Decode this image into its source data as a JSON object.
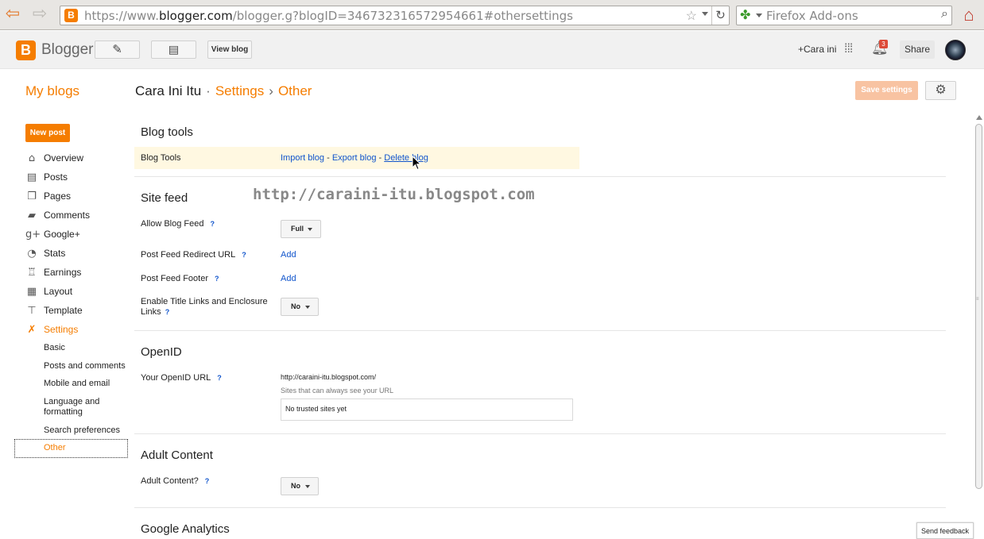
{
  "browser": {
    "url_host": "https://www.",
    "url_domain": "blogger.com",
    "url_path": "/blogger.g?blogID=346732316572954661#othersettings",
    "search_placeholder": "Firefox Add-ons"
  },
  "header": {
    "app_name": "Blogger",
    "view_blog": "View blog",
    "plus_user": "+Cara ini",
    "notification_count": "3",
    "share": "Share"
  },
  "title_row": {
    "my_blogs": "My blogs",
    "blog_name": "Cara Ini Itu",
    "sep1": "·",
    "settings": "Settings",
    "sep2": "›",
    "current": "Other",
    "save": "Save settings"
  },
  "sidebar": {
    "new_post": "New post",
    "items": [
      {
        "label": "Overview",
        "icon": "home-icon"
      },
      {
        "label": "Posts",
        "icon": "posts-icon"
      },
      {
        "label": "Pages",
        "icon": "pages-icon"
      },
      {
        "label": "Comments",
        "icon": "comment-icon"
      },
      {
        "label": "Google+",
        "icon": "google-plus-icon"
      },
      {
        "label": "Stats",
        "icon": "stats-icon"
      },
      {
        "label": "Earnings",
        "icon": "earnings-icon"
      },
      {
        "label": "Layout",
        "icon": "layout-icon"
      },
      {
        "label": "Template",
        "icon": "template-icon"
      },
      {
        "label": "Settings",
        "icon": "wrench-icon"
      }
    ],
    "sub_items": [
      "Basic",
      "Posts and comments",
      "Mobile and email",
      "Language and formatting",
      "Search preferences",
      "Other"
    ]
  },
  "sections": {
    "blog_tools": {
      "title": "Blog tools",
      "row_label": "Blog Tools",
      "import": "Import blog",
      "dash1": " - ",
      "export": "Export blog",
      "dash2": " - ",
      "delete": "Delete blog"
    },
    "site_feed": {
      "title": "Site feed",
      "allow_label": "Allow Blog Feed",
      "allow_value": "Full",
      "redirect_label": "Post Feed Redirect URL",
      "redirect_action": "Add",
      "footer_label": "Post Feed Footer",
      "footer_action": "Add",
      "title_links_label": "Enable Title Links and Enclosure Links",
      "title_links_value": "No"
    },
    "openid": {
      "title": "OpenID",
      "url_label": "Your OpenID URL",
      "url_value": "http://caraini-itu.blogspot.com/",
      "sites_label": "Sites that can always see your URL",
      "trusted": "No trusted sites yet"
    },
    "adult": {
      "title": "Adult Content",
      "label": "Adult Content?",
      "value": "No"
    },
    "analytics": {
      "title": "Google Analytics"
    }
  },
  "help_mark": "?",
  "watermark": "http://caraini-itu.blogspot.com",
  "send_feedback": "Send feedback"
}
